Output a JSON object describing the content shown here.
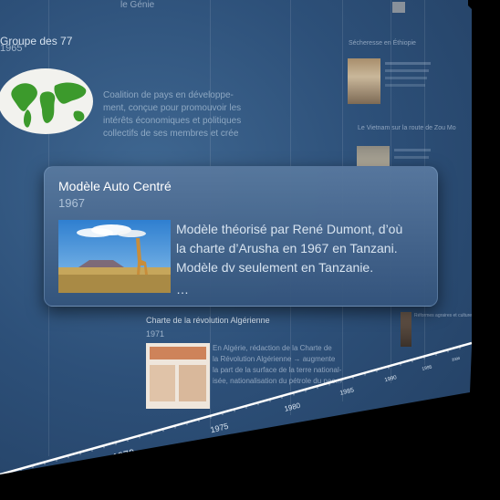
{
  "background_events": {
    "groupe77": {
      "title": "Groupe des 77",
      "year": "1965",
      "description": [
        "Coalition de pays en développe-",
        "ment, conçue pour promouvoir les",
        "intérêts économiques et politiques",
        "collectifs de ses membres et crée"
      ]
    },
    "top_right_snippet": "le Génie",
    "secheresse": {
      "title": "Sécheresse en Éthiopie"
    },
    "vietnam": {
      "title": "Le Vietnam sur la route de Zou Mo"
    },
    "algerie": {
      "title": "Charte de la révolution Algérienne",
      "year": "1971",
      "description": [
        "En Algérie, rédaction de la Charte de",
        "la Révolution Algérienne → augmente",
        "la part de la surface de la terre national-",
        "isée, nationalisation du pétrole du pac..."
      ]
    },
    "portrait_snippet": "Réformes agraires et cultures"
  },
  "focused_event": {
    "title": "Modèle Auto Centré",
    "year": "1967",
    "description": [
      "Modèle théorisé par René Dumont, d’où",
      "la charte d’Arusha en 1967 en Tanzani.",
      "Modèle dv seulement en Tanzanie."
    ],
    "ellipsis": "…",
    "image": "giraffe-savanna-photo"
  },
  "axis": {
    "labels": [
      "1970",
      "1975",
      "1980",
      "1985",
      "1990",
      "1995",
      "2000"
    ]
  },
  "colors": {
    "background": "#2d5079",
    "card": "#4a6e98",
    "axis": "#ffffff"
  }
}
